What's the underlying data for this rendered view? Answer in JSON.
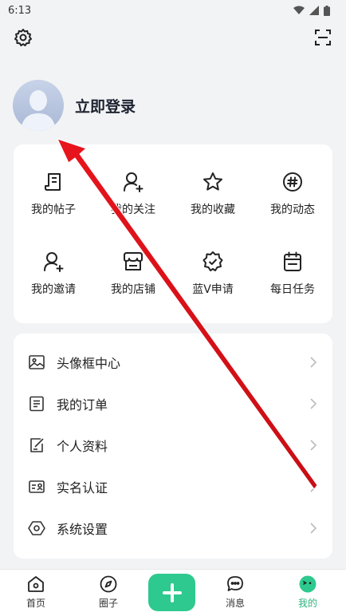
{
  "status_bar": {
    "time": "6:13"
  },
  "profile": {
    "login_label": "立即登录"
  },
  "grid_items": [
    {
      "label": "我的帖子",
      "icon": "post-icon"
    },
    {
      "label": "我的关注",
      "icon": "follow-user-icon"
    },
    {
      "label": "我的收藏",
      "icon": "star-icon"
    },
    {
      "label": "我的动态",
      "icon": "hashtag-icon"
    },
    {
      "label": "我的邀请",
      "icon": "invite-user-icon"
    },
    {
      "label": "我的店铺",
      "icon": "store-icon"
    },
    {
      "label": "蓝V申请",
      "icon": "verified-badge-icon"
    },
    {
      "label": "每日任务",
      "icon": "calendar-icon"
    }
  ],
  "list_items": [
    {
      "label": "头像框中心",
      "icon": "picture-icon"
    },
    {
      "label": "我的订单",
      "icon": "order-list-icon"
    },
    {
      "label": "个人资料",
      "icon": "edit-note-icon"
    },
    {
      "label": "实名认证",
      "icon": "id-card-icon"
    },
    {
      "label": "系统设置",
      "icon": "settings-hex-icon"
    }
  ],
  "bottom_nav": [
    {
      "label": "首页",
      "icon": "home-icon"
    },
    {
      "label": "圈子",
      "icon": "compass-icon"
    },
    {
      "label": "消息",
      "icon": "chat-icon"
    },
    {
      "label": "我的",
      "icon": "profile-face-icon",
      "active": true
    }
  ],
  "colors": {
    "accent": "#2ec98e",
    "active_label": "#2fb37c",
    "annotation_arrow": "#e8141c"
  }
}
